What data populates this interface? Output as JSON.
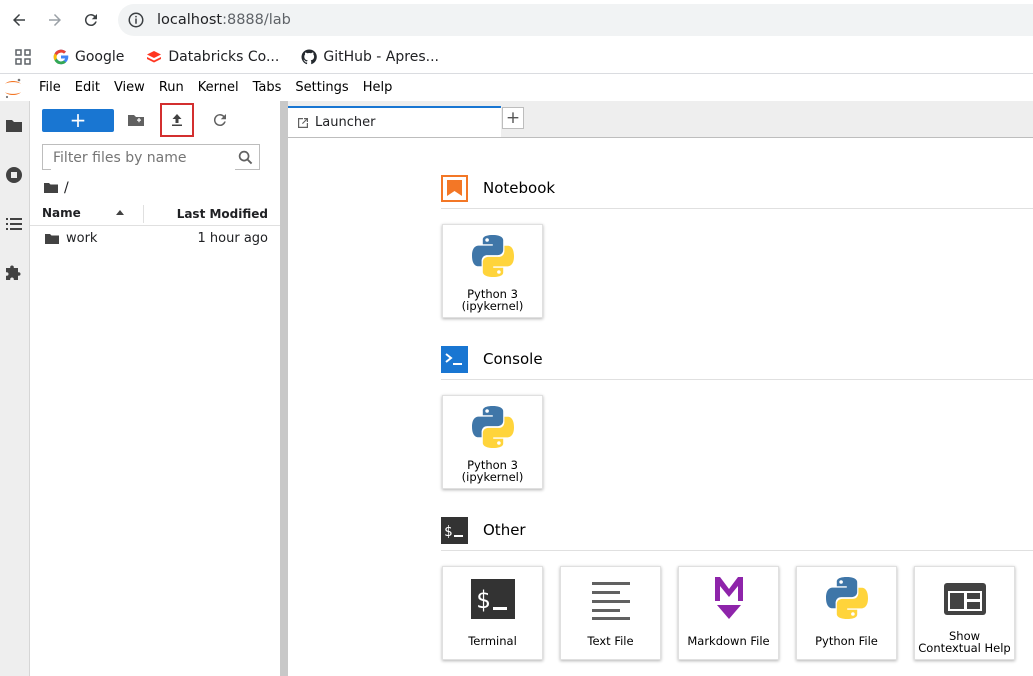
{
  "browser": {
    "url_host": "localhost",
    "url_rest": ":8888/lab",
    "bookmarks": [
      {
        "label": "Google",
        "icon": "google-icon"
      },
      {
        "label": "Databricks Co...",
        "icon": "databricks-icon"
      },
      {
        "label": "GitHub - Apres...",
        "icon": "github-icon"
      }
    ]
  },
  "menubar": {
    "items": [
      "File",
      "Edit",
      "View",
      "Run",
      "Kernel",
      "Tabs",
      "Settings",
      "Help"
    ]
  },
  "filebrowser": {
    "new_label": "+",
    "filter_placeholder": "Filter files by name",
    "breadcrumb": "/",
    "col_name": "Name",
    "col_modified": "Last Modified",
    "files": [
      {
        "name": "work",
        "modified": "1 hour ago",
        "type": "folder"
      }
    ]
  },
  "tabs": {
    "active_label": "Launcher",
    "add_label": "+"
  },
  "launcher": {
    "notebook": {
      "title": "Notebook",
      "cards": [
        {
          "line1": "Python 3",
          "line2": "(ipykernel)"
        }
      ]
    },
    "console": {
      "title": "Console",
      "cards": [
        {
          "line1": "Python 3",
          "line2": "(ipykernel)"
        }
      ]
    },
    "other": {
      "title": "Other",
      "cards": [
        {
          "line1": "Terminal",
          "line2": ""
        },
        {
          "line1": "Text File",
          "line2": ""
        },
        {
          "line1": "Markdown File",
          "line2": ""
        },
        {
          "line1": "Python File",
          "line2": ""
        },
        {
          "line1": "Show",
          "line2": "Contextual Help"
        }
      ]
    }
  },
  "colors": {
    "accent": "#1976d2",
    "highlight": "#d32f2f",
    "notebook_orange": "#f37726",
    "python_blue": "#3f76a8",
    "python_yellow": "#ffd43b",
    "markdown_purple": "#8e24aa"
  }
}
